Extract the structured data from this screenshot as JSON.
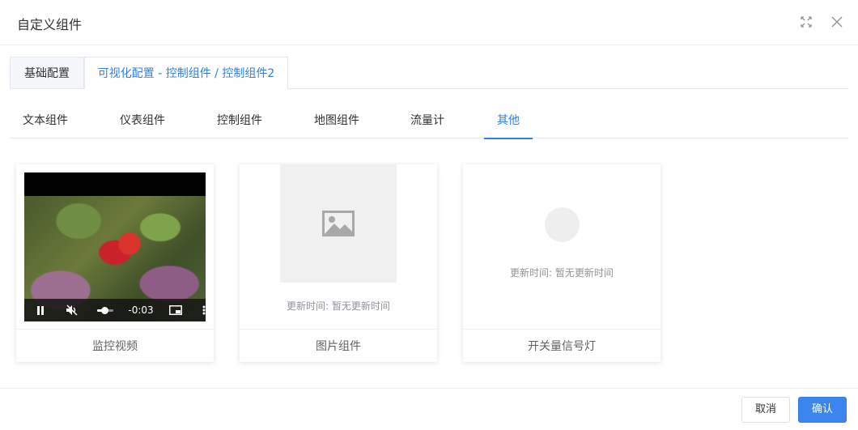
{
  "dialog": {
    "title": "自定义组件",
    "icons": {
      "fullscreen": "fullscreen-icon",
      "close": "close-icon"
    }
  },
  "main_tabs": [
    {
      "label": "基础配置",
      "active": false
    },
    {
      "label": "可视化配置 - 控制组件 / 控制组件2",
      "active": true
    }
  ],
  "sub_tabs": [
    {
      "label": "文本组件",
      "active": false
    },
    {
      "label": "仪表组件",
      "active": false
    },
    {
      "label": "控制组件",
      "active": false
    },
    {
      "label": "地图组件",
      "active": false
    },
    {
      "label": "流量计",
      "active": false
    },
    {
      "label": "其他",
      "active": true
    }
  ],
  "cards": [
    {
      "name": "监控视频",
      "video": {
        "time": "-0:03",
        "progress_fraction": 0.45,
        "muted": true,
        "playing": true
      }
    },
    {
      "name": "图片组件",
      "update_label": "更新时间:",
      "update_value": "暂无更新时间"
    },
    {
      "name": "开关量信号灯",
      "update_label": "更新时间:",
      "update_value": "暂无更新时间"
    }
  ],
  "footer": {
    "cancel_label": "取消",
    "confirm_label": "确认"
  },
  "colors": {
    "accent": "#2f7fe4",
    "border": "#e4e7ed",
    "muted_text": "#909399"
  }
}
